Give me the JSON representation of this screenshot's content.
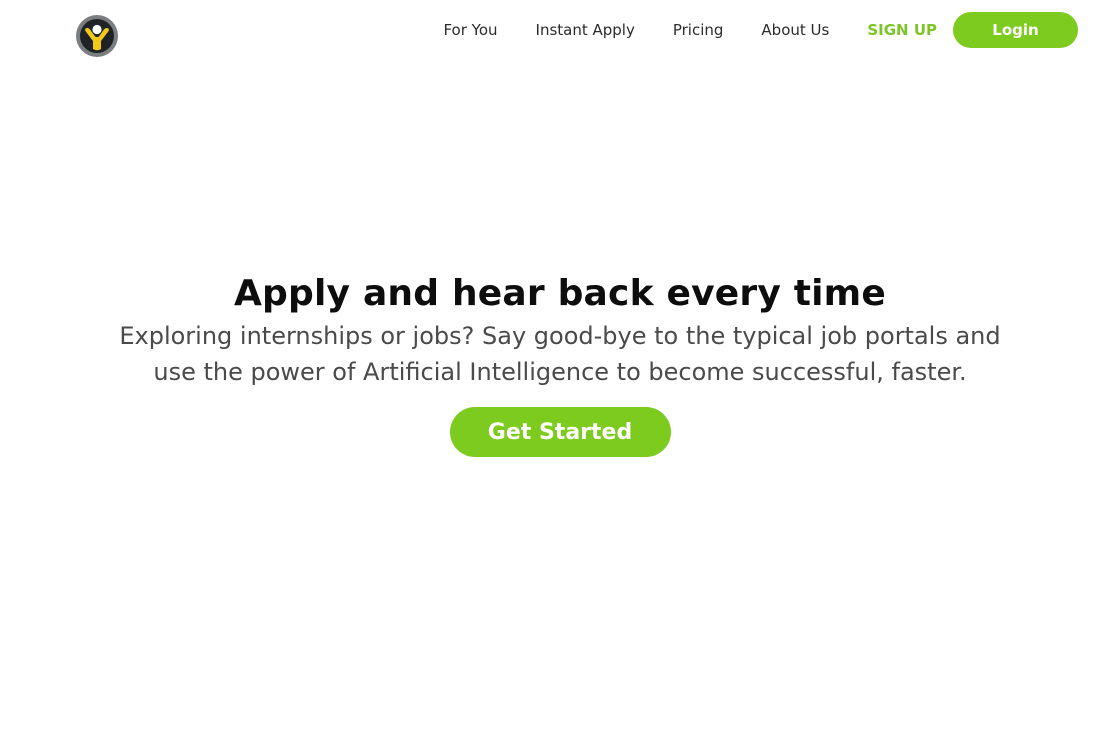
{
  "brand": {
    "logo_icon": "person-arms-raised-logo-icon",
    "logo_colors": {
      "ring": "#7a7e80",
      "inner": "#1f2326",
      "figure": "#f2c919",
      "head": "#ffffff"
    }
  },
  "nav": {
    "items": [
      {
        "label": "For You"
      },
      {
        "label": "Instant Apply"
      },
      {
        "label": "Pricing"
      },
      {
        "label": "About Us"
      }
    ],
    "signup_label": "SIGN UP",
    "login_label": "Login"
  },
  "hero": {
    "title": "Apply and hear back every time",
    "subtitle": "Exploring internships or jobs? Say good-bye to the typical job portals and use the power of Artificial Intelligence to become successful, faster.",
    "cta_label": "Get Started"
  },
  "colors": {
    "accent": "#7dcb1e",
    "signup_text": "#7cc427",
    "title_text": "#0d0d0d",
    "body_text": "#4a4a4a",
    "background": "#ffffff"
  }
}
